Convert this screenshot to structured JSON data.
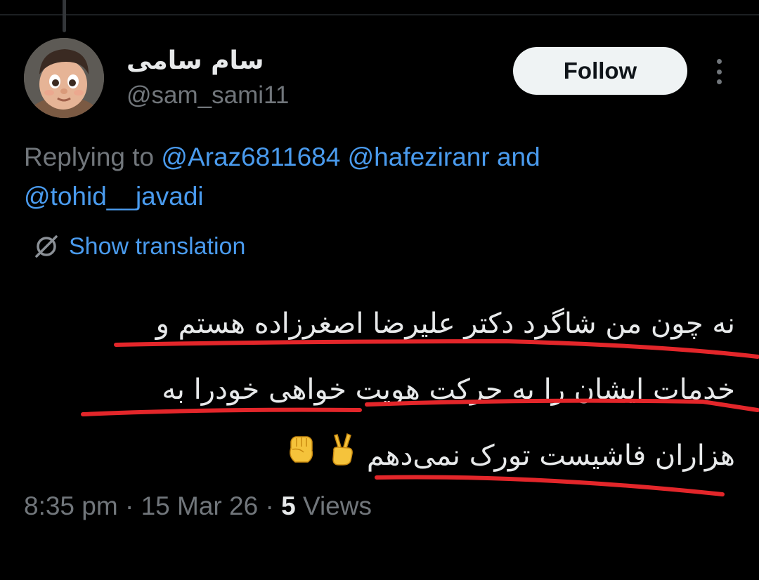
{
  "author": {
    "display_name": "سام سامی",
    "handle": "@sam_sami11"
  },
  "follow_button": {
    "label": "Follow"
  },
  "replying": {
    "prefix": "Replying to",
    "mentions": [
      "@Araz6811684",
      "@hafeziranr",
      "@tohid__javadi"
    ],
    "joiner": "and"
  },
  "translation": {
    "label": "Show translation"
  },
  "tweet": {
    "lines": [
      "نه چون من شاگرد دکتر علیرضا اصغرزاده هستم و",
      "خدمات ایشان را به حرکت هویت خواهی خودرا به",
      "هزاران فاشیست تورک نمی‌دهم"
    ],
    "emojis": [
      "raised-fist-emoji",
      "victory-hand-emoji"
    ]
  },
  "meta": {
    "time": "8:35 pm",
    "separator": "·",
    "date": "15 Mar 26",
    "views_count": "5",
    "views_label": "Views"
  },
  "colors": {
    "background": "#000000",
    "text": "#e7e9ea",
    "muted": "#71767b",
    "link": "#4a9bee",
    "annotation": "#e3262a"
  }
}
